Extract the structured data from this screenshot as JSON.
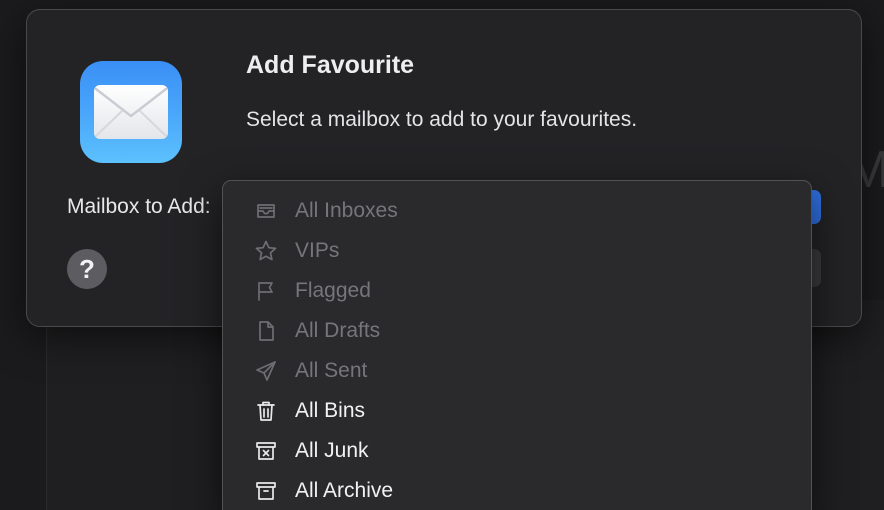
{
  "background": {
    "partial_glyph": "M"
  },
  "dialog": {
    "title": "Add Favourite",
    "message": "Select a mailbox to add to your favourites.",
    "field_label": "Mailbox to Add:",
    "help_label": "?",
    "app_icon": "mail-envelope-icon",
    "accent_color": "#2f6fe0"
  },
  "menu": {
    "items": [
      {
        "label": "All Inboxes",
        "icon": "inbox-tray-icon",
        "enabled": false
      },
      {
        "label": "VIPs",
        "icon": "star-icon",
        "enabled": false
      },
      {
        "label": "Flagged",
        "icon": "flag-icon",
        "enabled": false
      },
      {
        "label": "All Drafts",
        "icon": "document-icon",
        "enabled": false
      },
      {
        "label": "All Sent",
        "icon": "paper-plane-icon",
        "enabled": false
      },
      {
        "label": "All Bins",
        "icon": "trash-icon",
        "enabled": true
      },
      {
        "label": "All Junk",
        "icon": "junk-box-icon",
        "enabled": true
      },
      {
        "label": "All Archive",
        "icon": "archive-box-icon",
        "enabled": true
      }
    ]
  }
}
